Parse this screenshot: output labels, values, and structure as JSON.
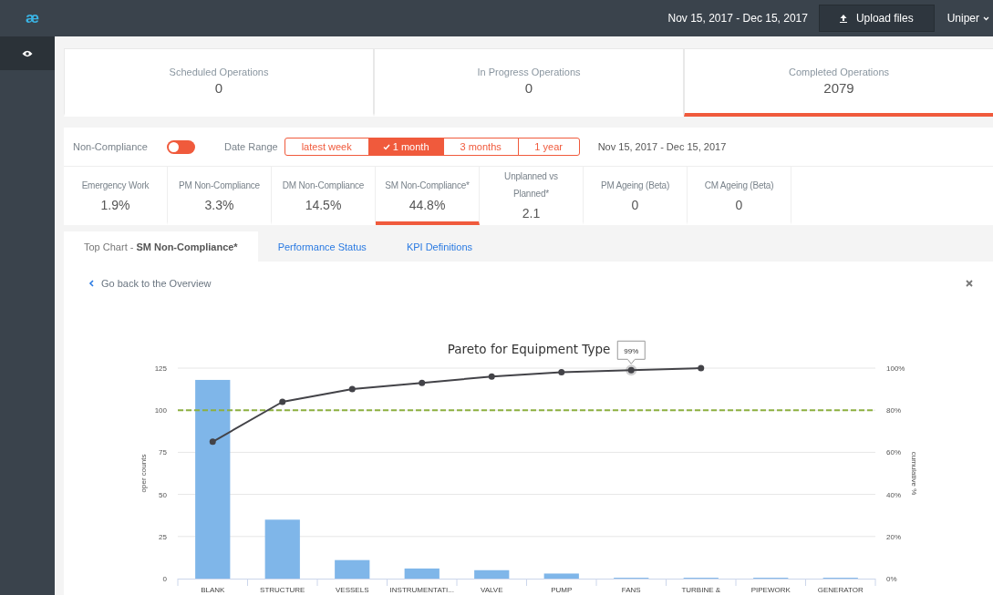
{
  "topbar": {
    "logo": "æ",
    "date_range": "Nov 15, 2017 - Dec 15, 2017",
    "upload_button": "Upload files",
    "account": "Uniper"
  },
  "summary_cards": [
    {
      "label": "Scheduled Operations",
      "value": "0",
      "selected": false
    },
    {
      "label": "In Progress Operations",
      "value": "0",
      "selected": false
    },
    {
      "label": "Completed Operations",
      "value": "2079",
      "selected": true
    }
  ],
  "filters": {
    "non_compliance_label": "Non-Compliance",
    "non_compliance_on": false,
    "date_range_label": "Date Range",
    "date_text": "Nov 15, 2017 - Dec 15, 2017",
    "ranges": [
      {
        "label": "latest week",
        "selected": false
      },
      {
        "label": "1 month",
        "selected": true
      },
      {
        "label": "3 months",
        "selected": false
      },
      {
        "label": "1 year",
        "selected": false
      }
    ]
  },
  "kpis": [
    {
      "label": "Emergency Work",
      "value": "1.9%",
      "selected": false
    },
    {
      "label": "PM Non-Compliance",
      "value": "3.3%",
      "selected": false
    },
    {
      "label": "DM Non-Compliance",
      "value": "14.5%",
      "selected": false
    },
    {
      "label": "SM Non-Compliance*",
      "value": "44.8%",
      "selected": true
    },
    {
      "label": "Unplanned vs Planned*",
      "value": "2.1",
      "selected": false
    },
    {
      "label": "PM Ageing (Beta)",
      "value": "0",
      "selected": false
    },
    {
      "label": "CM Ageing (Beta)",
      "value": "0",
      "selected": false
    }
  ],
  "tabs": [
    {
      "label": "Top Chart -",
      "detail": "SM Non-Compliance*",
      "selected": true
    },
    {
      "label": "Performance Status",
      "selected": false
    },
    {
      "label": "KPI Definitions",
      "selected": false
    }
  ],
  "back_link": "Go back to the Overview",
  "chart_data": {
    "type": "bar",
    "title": "Pareto for Equipment Type",
    "ylabel": "oper counts",
    "y2label": "cumulative %",
    "grid": true,
    "categories": [
      "BLANK",
      "STRUCTURE",
      "VESSELS",
      "INSTRUMENTATI...",
      "VALVE",
      "PUMP",
      "FANS",
      "TURBINE &",
      "PIPEWORK",
      "GENERATOR"
    ],
    "series": [
      {
        "type": "bar",
        "color": "#7fb6e9",
        "values": [
          118,
          35,
          11,
          6,
          5,
          3,
          0.5,
          0.5,
          0.5,
          0.5
        ]
      },
      {
        "type": "line",
        "axis": "y2",
        "marker": "circle",
        "color": "#434348",
        "values": [
          65,
          84,
          90,
          93,
          96,
          98,
          99,
          100,
          null,
          null
        ]
      }
    ],
    "ylim": [
      0,
      125
    ],
    "yticks": [
      0,
      25,
      50,
      75,
      100,
      125
    ],
    "y2lim": [
      0,
      100
    ],
    "y2ticks": [
      {
        "value": 0,
        "label": "0%"
      },
      {
        "value": 20,
        "label": "20%"
      },
      {
        "value": 40,
        "label": "40%"
      },
      {
        "value": 60,
        "label": "60%"
      },
      {
        "value": 80,
        "label": "80%"
      },
      {
        "value": 100,
        "label": "100%"
      }
    ],
    "ref_lines": [
      {
        "axis": "y2",
        "value": 80,
        "color": "#8db040"
      }
    ],
    "annotations": [
      {
        "text": "99%",
        "x": "FANS",
        "y": 123.75
      }
    ]
  }
}
